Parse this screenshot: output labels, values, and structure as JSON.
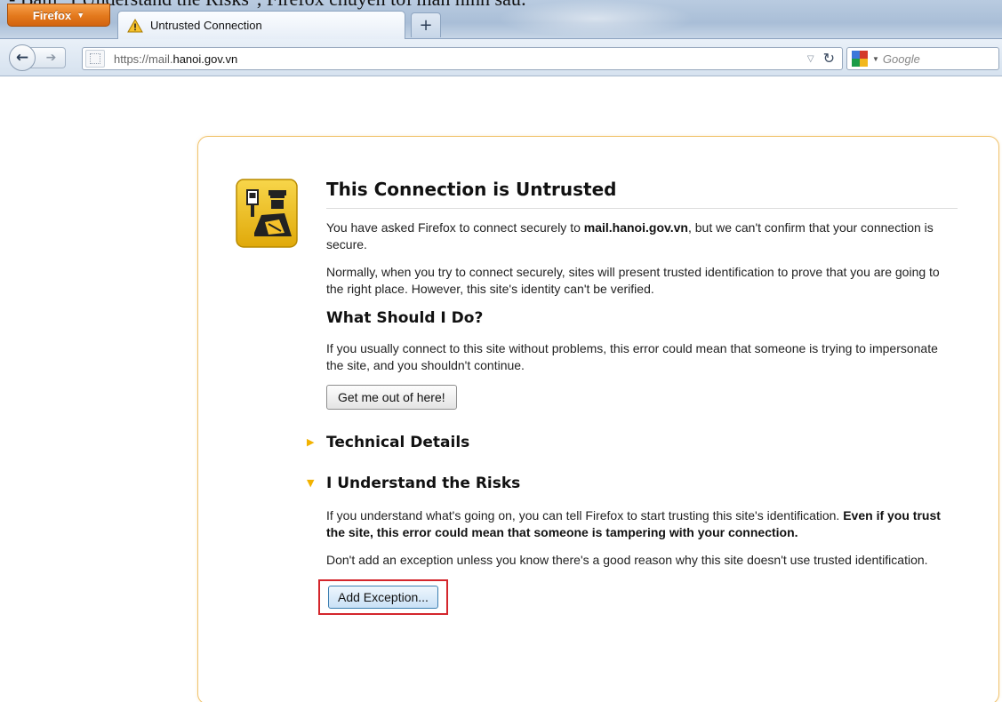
{
  "caption": "- Bấm \"I Understand the Risks\", Firefox chuyển tới màn hình sau:",
  "browser": {
    "app_button_label": "Firefox",
    "tab": {
      "title": "Untrusted Connection",
      "icon": "warning-icon"
    },
    "new_tab_label": "+",
    "url": {
      "prefix": "https://mail.",
      "host": "hanoi.gov.vn",
      "suffix": ""
    },
    "search_placeholder": "Google",
    "icons": {
      "back": "back-arrow-icon",
      "forward": "forward-arrow-icon",
      "reload": "reload-icon",
      "dropmarker": "dropdown-icon",
      "search_engine": "google-icon"
    }
  },
  "error_page": {
    "title": "This Connection is Untrusted",
    "icon": "police-officer-badge-icon",
    "intro_pre": "You have asked Firefox to connect securely to ",
    "intro_host": "mail.hanoi.gov.vn",
    "intro_post": ", but we can't confirm that your connection is secure.",
    "normally": "Normally, when you try to connect securely, sites will present trusted identification to prove that you are going to the right place. However, this site's identity can't be verified.",
    "what_heading": "What Should I Do?",
    "what_text": "If you usually connect to this site without problems, this error could mean that someone is trying to impersonate the site, and you shouldn't continue.",
    "get_out_label": "Get me out of here!",
    "technical_heading": "Technical Details",
    "risks_heading": "I Understand the Risks",
    "risks_text_plain": "If you understand what's going on, you can tell Firefox to start trusting this site's identification. ",
    "risks_text_bold": "Even if you trust the site, this error could mean that someone is tampering with your connection.",
    "dont_add_text": "Don't add an exception unless you know there's a good reason why this site doesn't use trusted identification.",
    "add_exception_label": "Add Exception..."
  },
  "colors": {
    "firefox_orange": "#e3781c",
    "error_border": "#f0c36d",
    "expander_triangle": "#f2b200",
    "highlight_red": "#d4262c"
  }
}
